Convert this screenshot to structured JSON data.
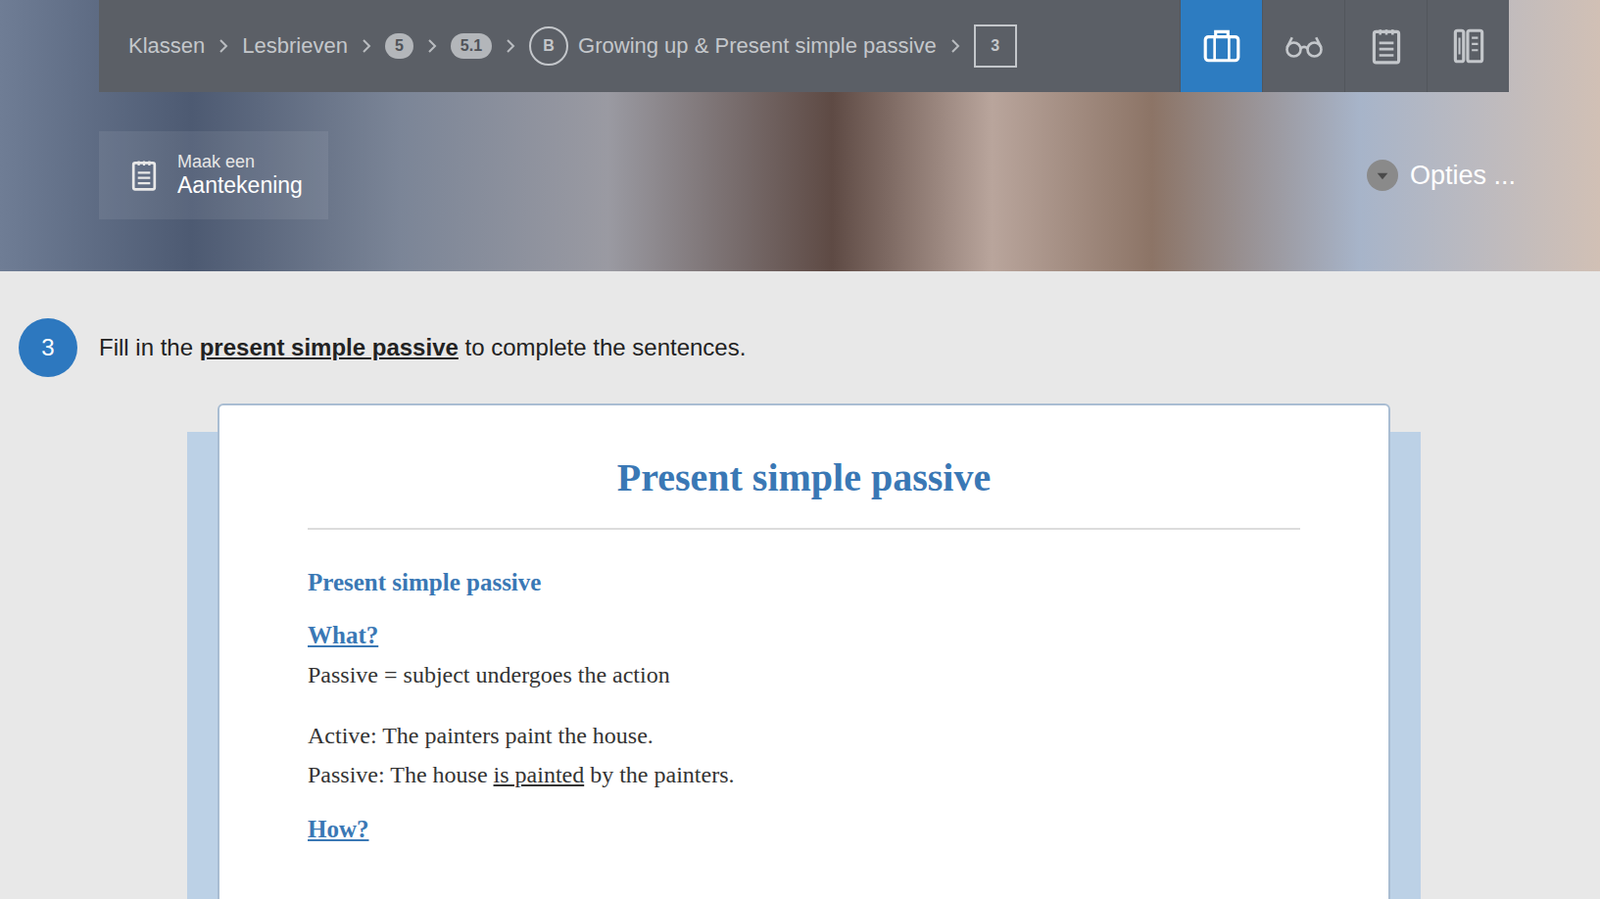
{
  "breadcrumb": [
    {
      "kind": "link",
      "text": "Klassen"
    },
    {
      "kind": "link",
      "text": "Lesbrieven"
    },
    {
      "kind": "badge",
      "text": "5"
    },
    {
      "kind": "badge",
      "text": "5.1"
    },
    {
      "kind": "lesson",
      "marker": "B",
      "text": "Growing up & Present simple passive"
    },
    {
      "kind": "box",
      "text": "3"
    }
  ],
  "toolbar": [
    {
      "kind": "briefcase",
      "selected": true
    },
    {
      "kind": "glasses",
      "selected": false
    },
    {
      "kind": "clipboard",
      "selected": false
    },
    {
      "kind": "book",
      "selected": false
    }
  ],
  "note_button": {
    "line1": "Maak een",
    "line2": "Aantekening"
  },
  "options": {
    "label": "Opties ..."
  },
  "exercise": {
    "number": "3",
    "instruction": [
      {
        "text": "Fill in the ",
        "emphasis": false
      },
      {
        "text": "present simple passive",
        "emphasis": true
      },
      {
        "text": " to complete the sentences.",
        "emphasis": false
      }
    ]
  },
  "card": {
    "title": "Present simple passive",
    "subtitle": "Present simple passive",
    "sections": [
      {
        "heading": "What?",
        "paragraphs": [
          [
            [
              {
                "text": "Passive = subject undergoes the action",
                "underline": false
              }
            ]
          ],
          [
            [
              {
                "text": "Active: The painters paint the house.",
                "underline": false
              }
            ],
            [
              {
                "text": "Passive: The house ",
                "underline": false
              },
              {
                "text": "is painted",
                "underline": true
              },
              {
                "text": " by the painters.",
                "underline": false
              }
            ]
          ]
        ]
      },
      {
        "heading": "How?",
        "paragraphs": []
      }
    ]
  }
}
